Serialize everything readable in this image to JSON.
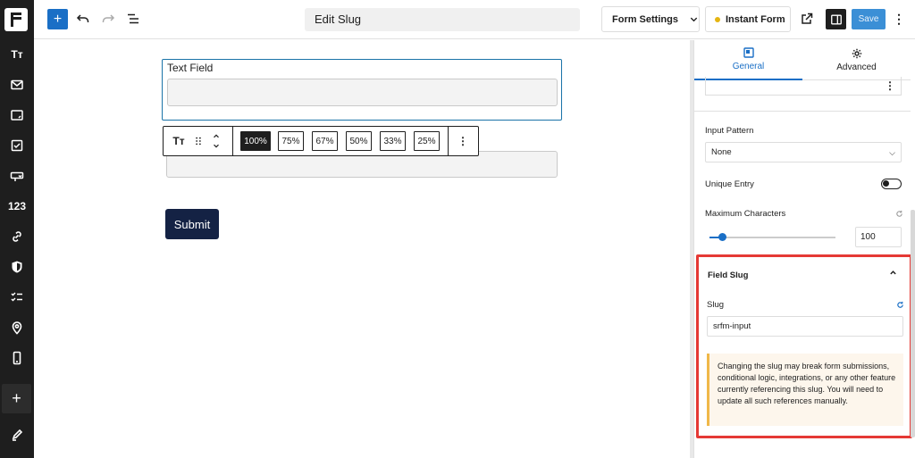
{
  "rail": {
    "items": [
      {
        "icon": "text-icon",
        "text": "Tт"
      },
      {
        "icon": "mail-icon"
      },
      {
        "icon": "textarea-icon"
      },
      {
        "icon": "checkbox-icon"
      },
      {
        "icon": "dropdown-icon"
      },
      {
        "icon": "number-icon",
        "text": "123"
      },
      {
        "icon": "link-icon"
      },
      {
        "icon": "shield-icon"
      },
      {
        "icon": "list-check-icon"
      },
      {
        "icon": "location-icon"
      },
      {
        "icon": "phone-icon"
      }
    ],
    "add_label": "+"
  },
  "topbar": {
    "title": "Edit Slug",
    "form_settings_label": "Form Settings",
    "instant_form_label": "Instant Form",
    "save_label": "Save"
  },
  "canvas": {
    "field_label": "Text Field",
    "width_options": [
      "100%",
      "75%",
      "67%",
      "50%",
      "33%",
      "25%"
    ],
    "active_width": "100%",
    "submit_label": "Submit"
  },
  "sidebar": {
    "tabs": [
      {
        "label": "General",
        "active": true,
        "icon": "block-icon"
      },
      {
        "label": "Advanced",
        "active": false,
        "icon": "gear-icon"
      }
    ],
    "input_pattern": {
      "label": "Input Pattern",
      "value": "None"
    },
    "unique_entry": {
      "label": "Unique Entry",
      "enabled": false
    },
    "max_chars": {
      "label": "Maximum Characters",
      "value": "100",
      "slider_fraction": 0.1
    },
    "field_slug": {
      "title": "Field Slug",
      "slug_label": "Slug",
      "slug_value": "srfm-input",
      "warning": "Changing the slug may break form submissions, conditional logic, integrations, or any other feature currently referencing this slug. You will need to update all such references manually."
    }
  },
  "colors": {
    "accent": "#1a6fc6",
    "highlight": "#e53935",
    "submit": "#142244",
    "warning_border": "#f0b849"
  }
}
